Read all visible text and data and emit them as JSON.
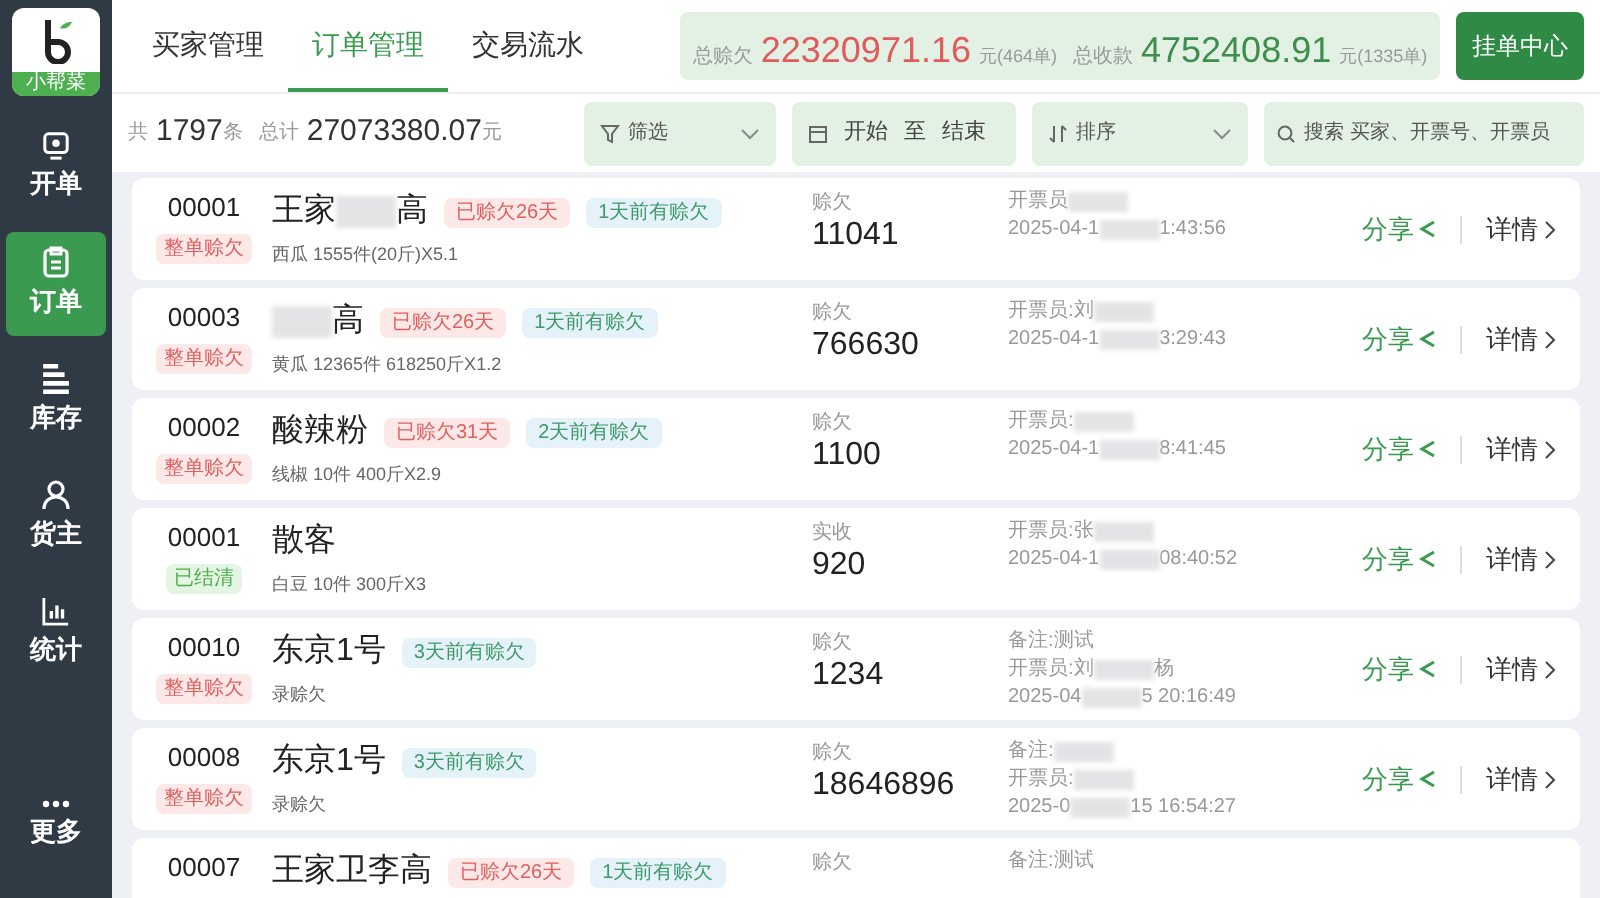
{
  "sidebar": {
    "logo_text": "小帮菜",
    "items": [
      {
        "label": "开单",
        "selected": false
      },
      {
        "label": "订单",
        "selected": true
      },
      {
        "label": "库存",
        "selected": false
      },
      {
        "label": "货主",
        "selected": false
      },
      {
        "label": "统计",
        "selected": false
      },
      {
        "label": "更多",
        "selected": false
      }
    ]
  },
  "tabs": [
    {
      "label": "买家管理",
      "selected": false
    },
    {
      "label": "订单管理",
      "selected": true
    },
    {
      "label": "交易流水",
      "selected": false
    }
  ],
  "summary": {
    "debt_label": "总赊欠",
    "debt_amount": "22320971.16",
    "debt_unit": "元(464单)",
    "paid_label": "总收款",
    "paid_amount": "4752408.91",
    "paid_unit": "元(1335单)"
  },
  "order_center_button": "挂单中心",
  "stats": {
    "count_prefix": "共",
    "count": "1797",
    "count_suffix": "条",
    "total_label": "总计",
    "total": "27073380.07",
    "total_unit": "元"
  },
  "filters": {
    "filter": "筛选",
    "date_start": "开始",
    "date_sep": "至",
    "date_end": "结束",
    "sort": "排序",
    "search_placeholder": "搜索 买家、开票号、开票员"
  },
  "orders": [
    {
      "no": "00001",
      "status": "整单赊欠",
      "settled": false,
      "name": [
        {
          "kind": "text",
          "text": "王家"
        },
        {
          "kind": "blur"
        },
        {
          "kind": "text",
          "text": "高"
        }
      ],
      "tags": [
        {
          "text": "已赊欠26天",
          "kind": "overdue"
        },
        {
          "text": "1天前有赊欠",
          "kind": "recent"
        }
      ],
      "detail": "西瓜 1555件(20斤)X5.1",
      "amount_label": "赊欠",
      "amount": "11041",
      "info": [
        [
          {
            "kind": "text",
            "text": "开票员"
          },
          {
            "kind": "blur"
          }
        ],
        [
          {
            "kind": "text",
            "text": "2025-04-1"
          },
          {
            "kind": "blur"
          },
          {
            "kind": "text",
            "text": "1:43:56"
          }
        ]
      ],
      "share": "分享",
      "details": "详情"
    },
    {
      "no": "00003",
      "status": "整单赊欠",
      "settled": false,
      "name": [
        {
          "kind": "blur"
        },
        {
          "kind": "text",
          "text": "高"
        }
      ],
      "tags": [
        {
          "text": "已赊欠26天",
          "kind": "overdue"
        },
        {
          "text": "1天前有赊欠",
          "kind": "recent"
        }
      ],
      "detail": "黄瓜 12365件 618250斤X1.2",
      "amount_label": "赊欠",
      "amount": "766630",
      "info": [
        [
          {
            "kind": "text",
            "text": "开票员:刘"
          },
          {
            "kind": "blur"
          }
        ],
        [
          {
            "kind": "text",
            "text": "2025-04-1"
          },
          {
            "kind": "blur"
          },
          {
            "kind": "text",
            "text": "3:29:43"
          }
        ]
      ],
      "share": "分享",
      "details": "详情"
    },
    {
      "no": "00002",
      "status": "整单赊欠",
      "settled": false,
      "name": [
        {
          "kind": "text",
          "text": "酸辣粉"
        }
      ],
      "tags": [
        {
          "text": "已赊欠31天",
          "kind": "overdue"
        },
        {
          "text": "2天前有赊欠",
          "kind": "recent"
        }
      ],
      "detail": "线椒 10件 400斤X2.9",
      "amount_label": "赊欠",
      "amount": "1100",
      "info": [
        [
          {
            "kind": "text",
            "text": "开票员:"
          },
          {
            "kind": "blur"
          }
        ],
        [
          {
            "kind": "text",
            "text": "2025-04-1"
          },
          {
            "kind": "blur"
          },
          {
            "kind": "text",
            "text": "8:41:45"
          }
        ]
      ],
      "share": "分享",
      "details": "详情"
    },
    {
      "no": "00001",
      "status": "已结清",
      "settled": true,
      "name": [
        {
          "kind": "text",
          "text": "散客"
        }
      ],
      "detail": "白豆 10件 300斤X3",
      "amount_label": "实收",
      "amount": "920",
      "info": [
        [
          {
            "kind": "text",
            "text": "开票员:张"
          },
          {
            "kind": "blur"
          }
        ],
        [
          {
            "kind": "text",
            "text": "2025-04-1"
          },
          {
            "kind": "blur"
          },
          {
            "kind": "text",
            "text": "08:40:52"
          }
        ]
      ],
      "share": "分享",
      "details": "详情"
    },
    {
      "no": "00010",
      "status": "整单赊欠",
      "settled": false,
      "name": [
        {
          "kind": "text",
          "text": "东京1号"
        }
      ],
      "tags": [
        {
          "text": "3天前有赊欠",
          "kind": "recent"
        }
      ],
      "detail": "录赊欠",
      "amount_label": "赊欠",
      "amount": "1234",
      "info": [
        [
          {
            "kind": "text",
            "text": "备注:测试"
          }
        ],
        [
          {
            "kind": "text",
            "text": "开票员:刘"
          },
          {
            "kind": "blur"
          },
          {
            "kind": "text",
            "text": "杨"
          }
        ],
        [
          {
            "kind": "text",
            "text": "2025-04"
          },
          {
            "kind": "blur"
          },
          {
            "kind": "text",
            "text": "5 20:16:49"
          }
        ]
      ],
      "share": "分享",
      "details": "详情"
    },
    {
      "no": "00008",
      "status": "整单赊欠",
      "settled": false,
      "name": [
        {
          "kind": "text",
          "text": "东京1号"
        }
      ],
      "tags": [
        {
          "text": "3天前有赊欠",
          "kind": "recent"
        }
      ],
      "detail": "录赊欠",
      "amount_label": "赊欠",
      "amount": "18646896",
      "info": [
        [
          {
            "kind": "text",
            "text": "备注:"
          },
          {
            "kind": "blur"
          }
        ],
        [
          {
            "kind": "text",
            "text": "开票员:"
          },
          {
            "kind": "blur"
          }
        ],
        [
          {
            "kind": "text",
            "text": "2025-0"
          },
          {
            "kind": "blur"
          },
          {
            "kind": "text",
            "text": "15 16:54:27"
          }
        ]
      ],
      "share": "分享",
      "details": "详情"
    },
    {
      "no": "00007",
      "name": [
        {
          "kind": "text",
          "text": "王家卫李高"
        }
      ],
      "tags": [
        {
          "text": "已赊欠26天",
          "kind": "overdue"
        },
        {
          "text": "1天前有赊欠",
          "kind": "recent"
        }
      ],
      "amount_label": "赊欠",
      "info": [
        [
          {
            "kind": "text",
            "text": "备注:测试"
          }
        ]
      ]
    }
  ]
}
